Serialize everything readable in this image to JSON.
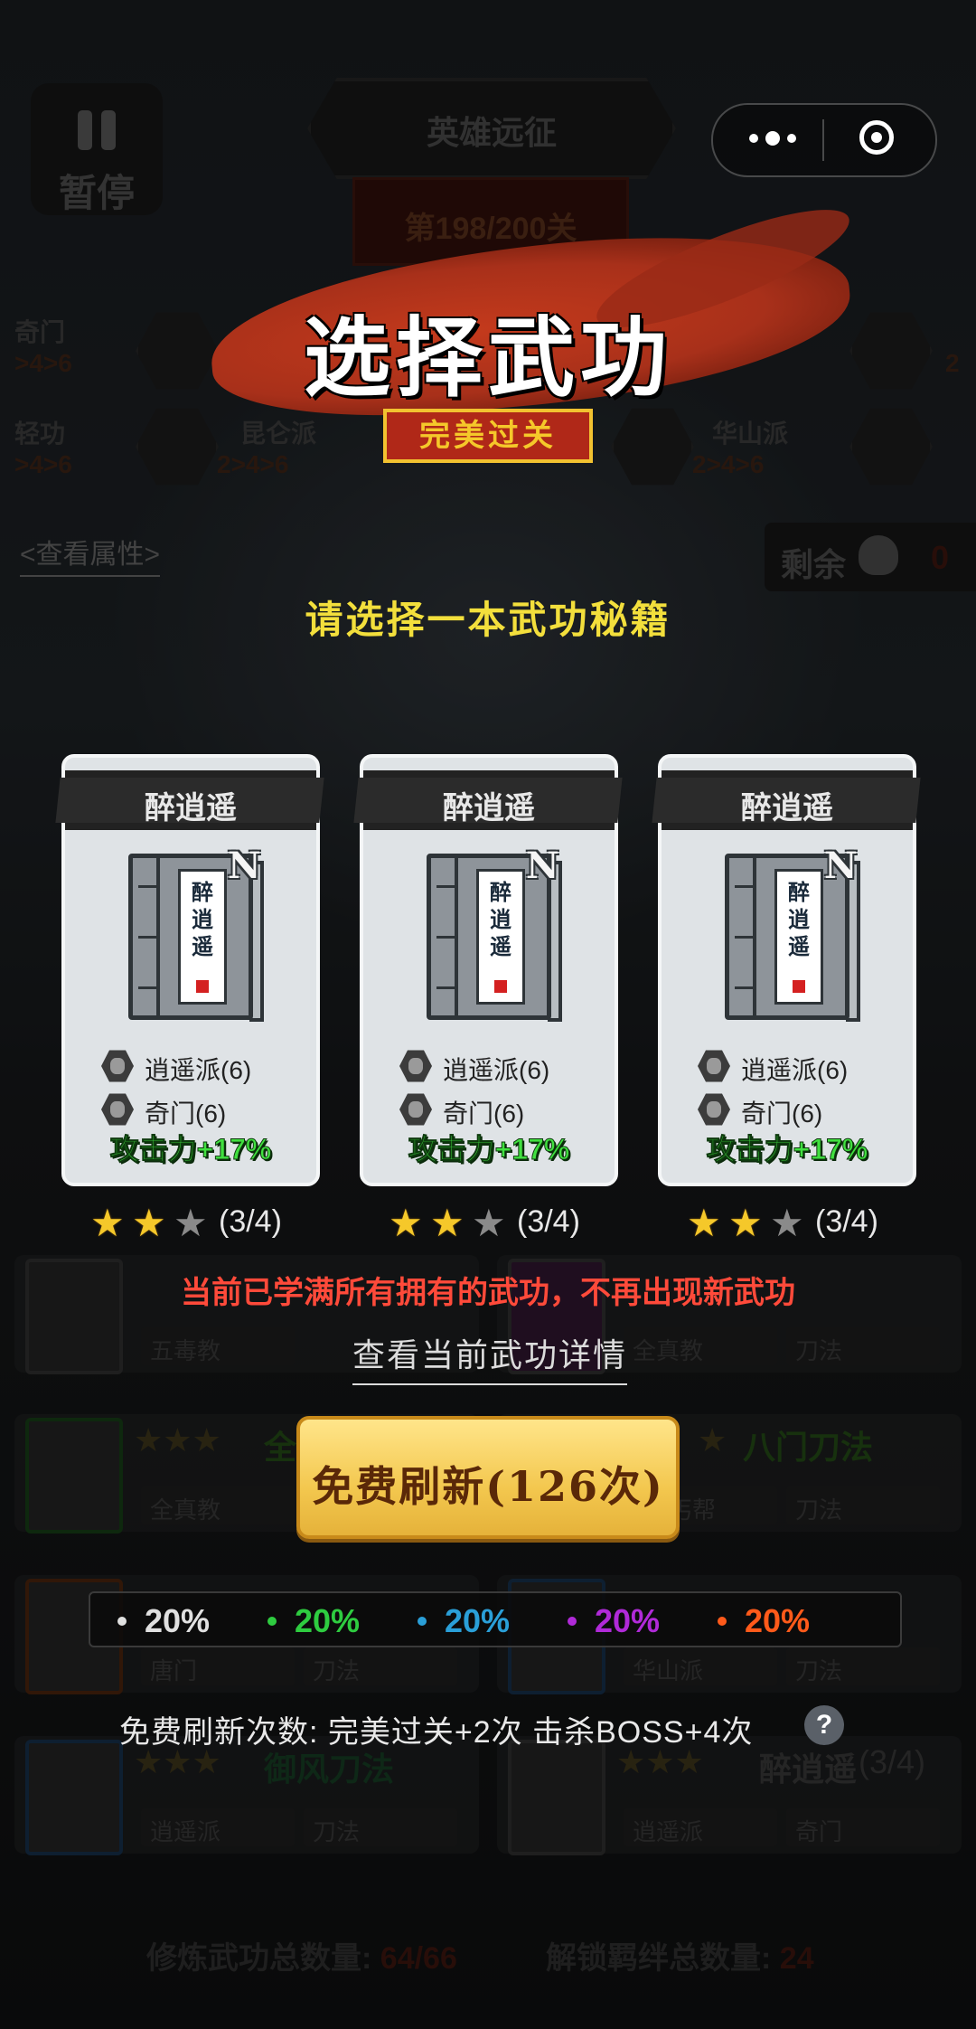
{
  "hud": {
    "pause_label": "暂停",
    "stage_title": "英雄远征",
    "level": "第198/200关",
    "view_attrs": "<查看属性>",
    "remaining_label": "剩余",
    "remaining_value": "0"
  },
  "bg_factions": {
    "row1_left": "奇门",
    "row1_left_sub": ">4>6",
    "row1_right_sub": "2",
    "row2_left": "轻功",
    "row2_left_sub": ">4>6",
    "kunlun": "昆仑派",
    "kunlun_sub": "2>4>6",
    "huashan": "华山派",
    "huashan_sub": "2>4>6"
  },
  "bg_list": {
    "row1_tag1": "五毒教",
    "row1_tag2": "全真教",
    "row1_tag3": "刀法",
    "row2_name_left": "全",
    "row2_name_right": "八门刀法",
    "row2_tag1": "全真教",
    "row2_tag2": "丐帮",
    "row2_tag3": "刀法",
    "row2_tag4": "刀法",
    "row3_tag1": "唐门",
    "row3_tag2": "刀法",
    "row3_tag3": "华山派",
    "row3_tag4": "刀法",
    "row4_name_left": "御风刀法",
    "row4_name_right": "醉逍遥",
    "row4_count": "(3/4)",
    "row4_tag1": "逍遥派",
    "row4_tag2": "刀法",
    "row4_tag3": "逍遥派",
    "row4_tag4": "奇门"
  },
  "footer": {
    "total_label": "修炼武功总数量:",
    "total_value": "64/66",
    "bond_label": "解锁羁绊总数量:",
    "bond_value": "24"
  },
  "capsule": {
    "more_icon": "more-dots-icon",
    "close_icon": "target-icon"
  },
  "modal": {
    "title": "选择武功",
    "perfect_badge": "完美过关",
    "prompt": "请选择一本武功秘籍",
    "maxed_message": "当前已学满所有拥有的武功，不再出现新武功",
    "details_link": "查看当前武功详情",
    "refresh_button": "免费刷新(126次)",
    "rule_text": "免费刷新次数: 完美过关+2次  击杀BOSS+4次",
    "help_icon": "?"
  },
  "cards": [
    {
      "name": "醉逍遥",
      "book_label": "醉逍遥",
      "book_mark": "N",
      "traits": [
        "逍遥派(6)",
        "奇门(6)"
      ],
      "bonus": "攻击力+17%",
      "stars_filled": 2,
      "stars_total": 3,
      "stars_text": "(3/4)"
    },
    {
      "name": "醉逍遥",
      "book_label": "醉逍遥",
      "book_mark": "N",
      "traits": [
        "逍遥派(6)",
        "奇门(6)"
      ],
      "bonus": "攻击力+17%",
      "stars_filled": 2,
      "stars_total": 3,
      "stars_text": "(3/4)"
    },
    {
      "name": "醉逍遥",
      "book_label": "醉逍遥",
      "book_mark": "N",
      "traits": [
        "逍遥派(6)",
        "奇门(6)"
      ],
      "bonus": "攻击力+17%",
      "stars_filled": 2,
      "stars_total": 3,
      "stars_text": "(3/4)"
    }
  ],
  "odds": [
    {
      "value": "20%",
      "color": "#e0e0e0"
    },
    {
      "value": "20%",
      "color": "#2ecc40"
    },
    {
      "value": "20%",
      "color": "#2a9fd8"
    },
    {
      "value": "20%",
      "color": "#b02ad8"
    },
    {
      "value": "20%",
      "color": "#ff5a1a"
    }
  ],
  "colors": {
    "accent_gold": "#f5c82a",
    "bonus_green": "#41e040",
    "warning_red": "#ff4a3a",
    "brush_red": "#c43a1c"
  }
}
